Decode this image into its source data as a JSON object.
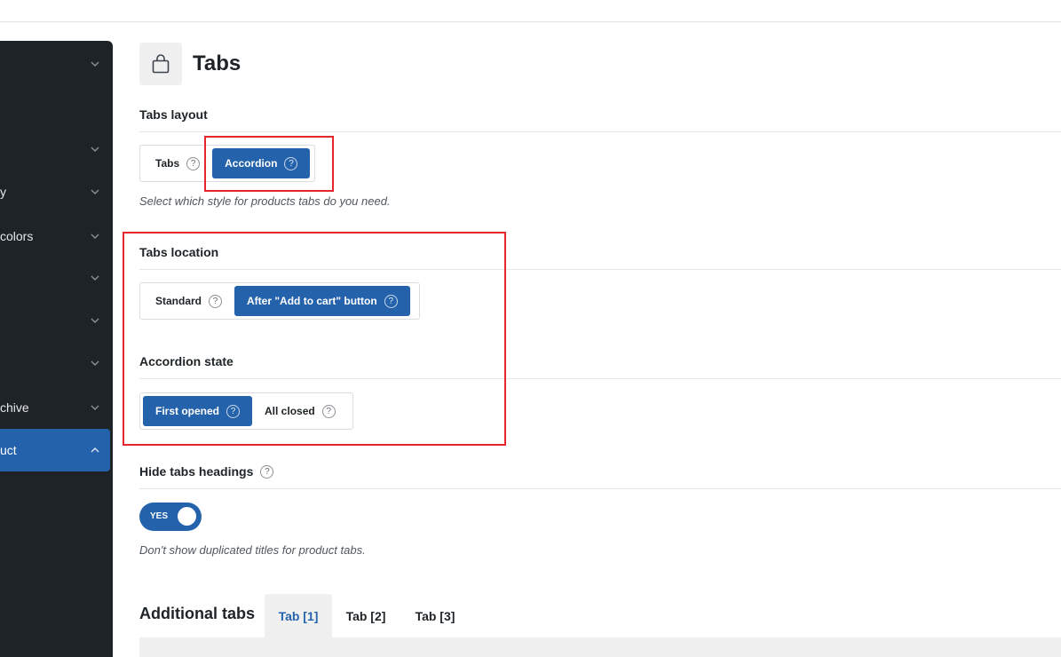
{
  "sidebar": {
    "items": [
      {
        "label": ""
      },
      {
        "label": ""
      },
      {
        "label": "y"
      },
      {
        "label": "colors"
      },
      {
        "label": ""
      },
      {
        "label": ""
      },
      {
        "label": ""
      },
      {
        "label": "chive"
      },
      {
        "label": "uct"
      }
    ]
  },
  "page": {
    "title": "Tabs",
    "icon": "shopping-bag-icon"
  },
  "tabs_layout": {
    "title": "Tabs layout",
    "options": [
      "Tabs",
      "Accordion"
    ],
    "selected": "Accordion",
    "help_glyph": "?",
    "description": "Select which style for products tabs do you need."
  },
  "tabs_location": {
    "title": "Tabs location",
    "options": [
      "Standard",
      "After \"Add to cart\" button"
    ],
    "selected": "After \"Add to cart\" button",
    "help_glyph": "?"
  },
  "accordion_state": {
    "title": "Accordion state",
    "options": [
      "First opened",
      "All closed"
    ],
    "selected": "First opened",
    "help_glyph": "?"
  },
  "hide_headings": {
    "title": "Hide tabs headings",
    "help_glyph": "?",
    "toggle_label": "YES",
    "value": true,
    "description": "Don't show duplicated titles for product tabs."
  },
  "additional_tabs": {
    "title": "Additional tabs",
    "tabs": [
      "Tab [1]",
      "Tab [2]",
      "Tab [3]"
    ],
    "active": "Tab [1]"
  },
  "colors": {
    "accent": "#2462ab",
    "sidebar_bg": "#1e2327",
    "highlight": "#e5262b"
  }
}
